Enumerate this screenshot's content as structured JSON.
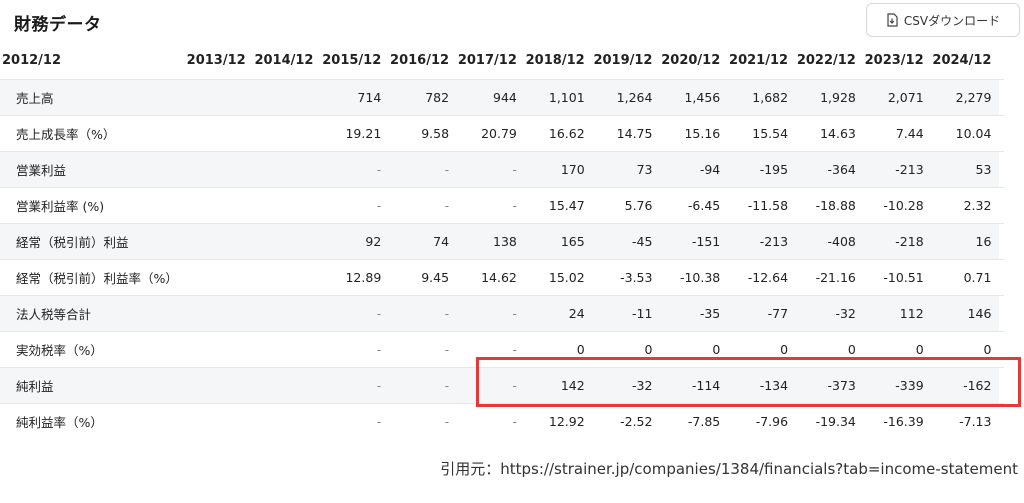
{
  "header": {
    "title": "財務データ",
    "csv_button_label": "CSVダウンロード"
  },
  "table": {
    "years": [
      "2012/12",
      "2013/12",
      "2014/12",
      "2015/12",
      "2016/12",
      "2017/12",
      "2018/12",
      "2019/12",
      "2020/12",
      "2021/12",
      "2022/12",
      "2023/12",
      "2024/12"
    ],
    "rows": [
      {
        "label": "売上高",
        "values": [
          "",
          "",
          "",
          "714",
          "782",
          "944",
          "1,101",
          "1,264",
          "1,456",
          "1,682",
          "1,928",
          "2,071",
          "2,279"
        ]
      },
      {
        "label": "売上成長率（%）",
        "values": [
          "",
          "",
          "",
          "19.21",
          "9.58",
          "20.79",
          "16.62",
          "14.75",
          "15.16",
          "15.54",
          "14.63",
          "7.44",
          "10.04"
        ]
      },
      {
        "label": "営業利益",
        "values": [
          "",
          "",
          "",
          "-",
          "-",
          "-",
          "170",
          "73",
          "-94",
          "-195",
          "-364",
          "-213",
          "53"
        ]
      },
      {
        "label": "営業利益率 (%)",
        "values": [
          "",
          "",
          "",
          "-",
          "-",
          "-",
          "15.47",
          "5.76",
          "-6.45",
          "-11.58",
          "-18.88",
          "-10.28",
          "2.32"
        ]
      },
      {
        "label": "経常（税引前）利益",
        "values": [
          "",
          "",
          "",
          "92",
          "74",
          "138",
          "165",
          "-45",
          "-151",
          "-213",
          "-408",
          "-218",
          "16"
        ]
      },
      {
        "label": "経常（税引前）利益率（%）",
        "values": [
          "",
          "",
          "",
          "12.89",
          "9.45",
          "14.62",
          "15.02",
          "-3.53",
          "-10.38",
          "-12.64",
          "-21.16",
          "-10.51",
          "0.71"
        ]
      },
      {
        "label": "法人税等合計",
        "values": [
          "",
          "",
          "",
          "-",
          "-",
          "-",
          "24",
          "-11",
          "-35",
          "-77",
          "-32",
          "112",
          "146"
        ]
      },
      {
        "label": "実効税率（%）",
        "values": [
          "",
          "",
          "",
          "-",
          "-",
          "-",
          "0",
          "0",
          "0",
          "0",
          "0",
          "0",
          "0"
        ]
      },
      {
        "label": "純利益",
        "values": [
          "",
          "",
          "",
          "-",
          "-",
          "-",
          "142",
          "-32",
          "-114",
          "-134",
          "-373",
          "-339",
          "-162"
        ]
      },
      {
        "label": "純利益率（%）",
        "values": [
          "",
          "",
          "",
          "-",
          "-",
          "-",
          "12.92",
          "-2.52",
          "-7.85",
          "-7.96",
          "-19.34",
          "-16.39",
          "-7.13"
        ]
      }
    ]
  },
  "source": "引用元：https://strainer.jp/companies/1384/financials?tab=income-statement",
  "colors": {
    "highlight": "#e53935",
    "row_alt": "#f4f6f8"
  }
}
